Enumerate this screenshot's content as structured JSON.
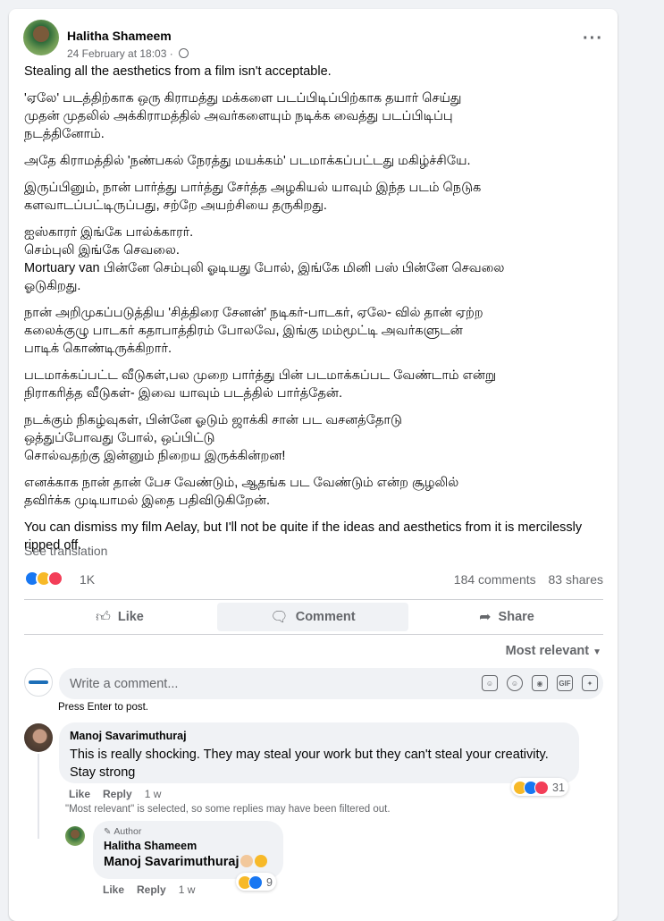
{
  "post": {
    "author": "Halitha Shameem",
    "timestamp": "24 February at 18:03 ·",
    "paragraphs": [
      "Stealing all the aesthetics from a film isn't acceptable.",
      "'ஏலே' படத்திற்காக ஒரு கிராமத்து மக்களை படப்பிடிப்பிற்காக தயார் செய்து\nமுதன் முதலில் அக்கிராமத்தில் அவர்களையும் நடிக்க வைத்து படப்பிடிப்பு\nநடத்தினோம்.",
      "அதே கிராமத்தில் 'நண்பகல் நேரத்து மயக்கம்' படமாக்கப்பட்டது மகிழ்ச்சியே.",
      "இருப்பினும், நான் பார்த்து பார்த்து சேர்த்த அழகியல் யாவும் இந்த படம் நெடுக\nகளவாடப்பட்டிருப்பது, சற்றே அயற்சியை தருகிறது.",
      "ஐஸ்காரர் இங்கே பால்க்காரர்.\nசெம்புலி இங்கே செவலை.\nMortuary van பின்னே செம்புலி ஓடியது போல், இங்கே மினி பஸ் பின்னே செவலை\nஓடுகிறது.",
      "நான் அறிமுகப்படுத்திய 'சித்திரை சேனன்' நடிகர்-பாடகர், ஏலே- வில் தான் ஏற்ற\nகலைக்குழு பாடகர் கதாபாத்திரம் போலவே, இங்கு மம்மூட்டி அவர்களுடன்\nபாடிக் கொண்டிருக்கிறார்.",
      "படமாக்கப்பட்ட வீடுகள்,பல முறை பார்த்து பின் படமாக்கப்பட வேண்டாம் என்று\nநிராகரித்த வீடுகள்- இவை யாவும் படத்தில் பார்த்தேன்.",
      "நடக்கும் நிகழ்வுகள், பின்னே ஓடும் ஜாக்கி சான் பட வசனத்தோடு\nஒத்துப்போவது போல், ஒப்பிட்டு\nசொல்வதற்கு இன்னும் நிறைய இருக்கின்றன!",
      "எனக்காக நான் தான் பேச வேண்டும், ஆதங்க பட வேண்டும் என்ற சூழலில்\nதவிர்க்க முடியாமல் இதை பதிவிடுகிறேன்.",
      "You can dismiss my film Aelay, but I'll not be quite if the ideas and aesthetics from it is mercilessly\nripped off."
    ],
    "see_translation": "See translation",
    "reaction_count": "1K",
    "comments_count": "184 comments",
    "shares_count": "83 shares"
  },
  "actions": {
    "like": "Like",
    "comment": "Comment",
    "share": "Share"
  },
  "sort_label": "Most relevant",
  "composer": {
    "placeholder": "Write a comment...",
    "hint": "Press Enter to post."
  },
  "comments": [
    {
      "name": "Manoj Savarimuthuraj",
      "text": "This is really shocking. They may steal your work but they can't steal your creativity. Stay strong",
      "like": "Like",
      "reply": "Reply",
      "time": "1 w",
      "reaction_count": "31"
    }
  ],
  "filter_note": "\"Most relevant\" is selected, so some replies may have been filtered out.",
  "reply": {
    "author_badge": "Author",
    "name": "Halitha Shameem",
    "text": "Manoj Savarimuthuraj",
    "like": "Like",
    "reply": "Reply",
    "time": "1 w",
    "reaction_count": "9"
  },
  "colors": {
    "accent": "#1877f2",
    "text_secondary": "#65676b",
    "bubble": "#f0f2f5"
  }
}
